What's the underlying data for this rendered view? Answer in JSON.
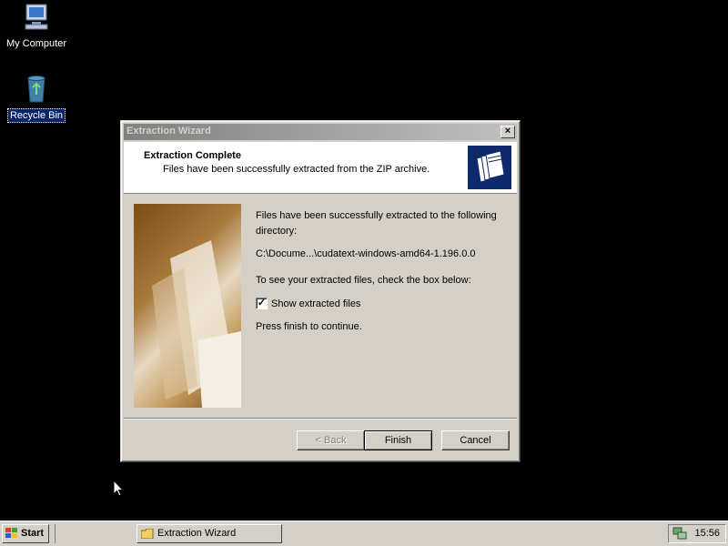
{
  "desktop": {
    "icons": [
      {
        "label": "My Computer",
        "name": "my-computer-icon"
      },
      {
        "label": "Recycle Bin",
        "name": "recycle-bin-icon"
      }
    ]
  },
  "dialog": {
    "title": "Extraction Wizard",
    "close_label": "×",
    "header_title": "Extraction Complete",
    "header_subtitle": "Files have been successfully extracted from the ZIP archive.",
    "body_line1": "Files have been successfully extracted to the following",
    "body_line2": "directory:",
    "path": "C:\\Docume...\\cudatext-windows-amd64-1.196.0.0",
    "check_prompt": "To see your extracted files, check the box below:",
    "checkbox_label": "Show extracted files",
    "checkbox_checked": true,
    "checkbox_mark": "✓",
    "continue_text": "Press finish to continue.",
    "buttons": {
      "back": "< Back",
      "finish": "Finish",
      "cancel": "Cancel"
    }
  },
  "taskbar": {
    "start_label": "Start",
    "task_label": "Extraction Wizard",
    "clock": "15:56"
  },
  "colors": {
    "desktop_bg": "#000000",
    "dialog_bg": "#d4d0c8",
    "selection": "#0a246a"
  }
}
